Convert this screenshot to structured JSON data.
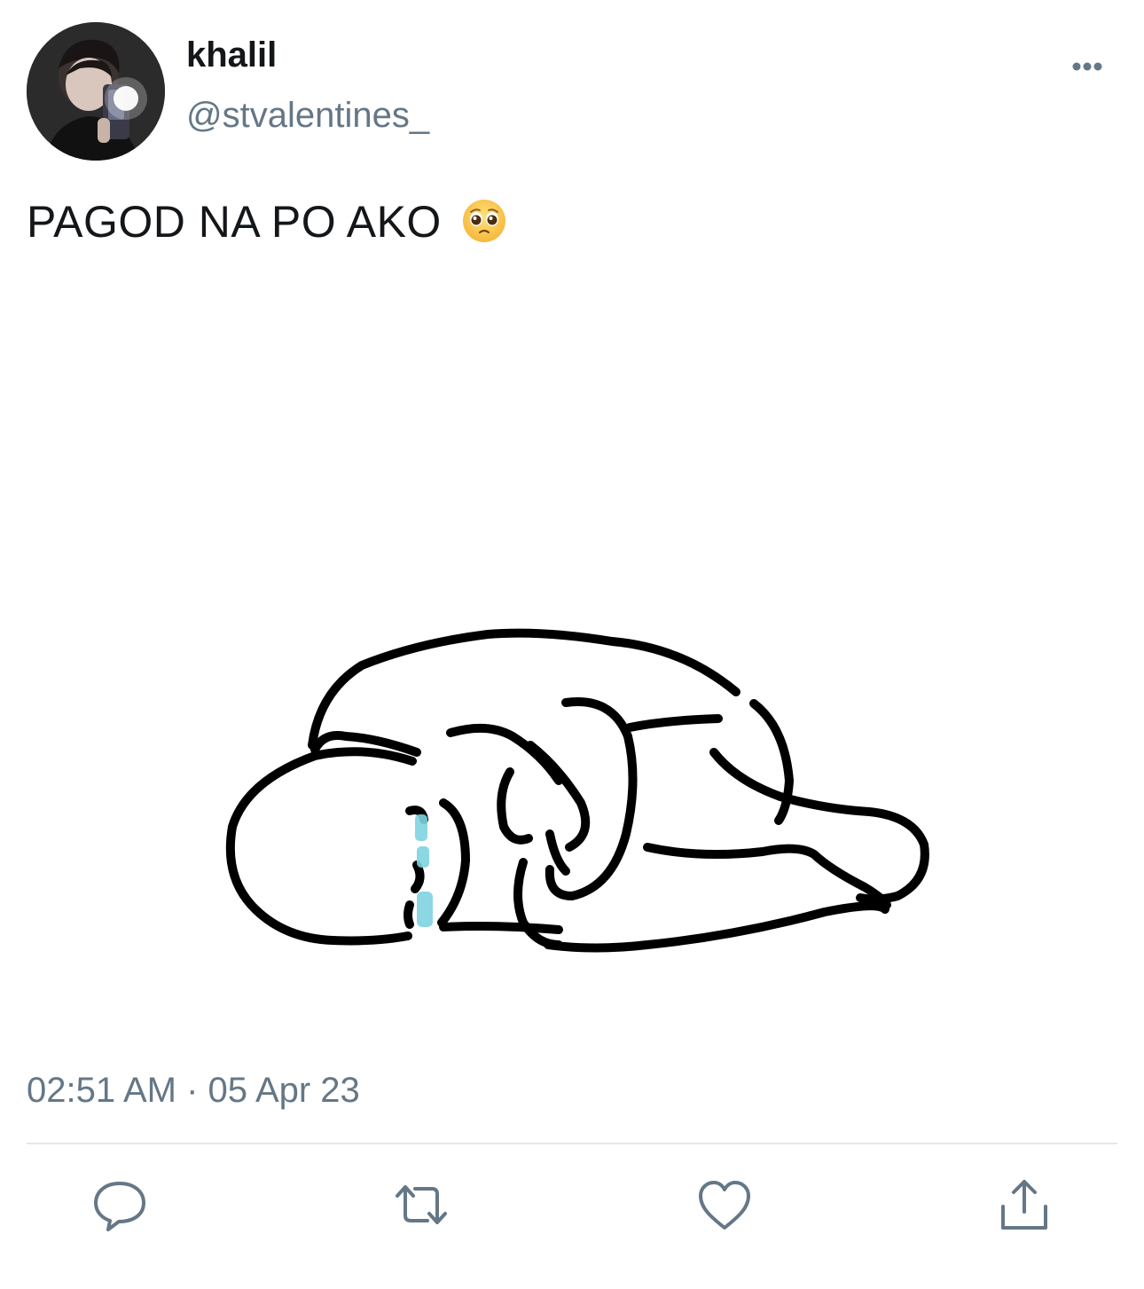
{
  "user": {
    "display_name": "khalil",
    "handle": "@stvalentines_"
  },
  "tweet": {
    "text": "PAGOD NA PO AKO",
    "emoji_icon": "pleading-face-emoji",
    "timestamp": "02:51 AM · 05 Apr 23"
  },
  "actions": {
    "reply_icon": "reply-icon",
    "retweet_icon": "retweet-icon",
    "like_icon": "heart-icon",
    "share_icon": "share-icon",
    "more_icon": "more-options-icon"
  },
  "colors": {
    "text_primary": "#14171a",
    "text_secondary": "#657786",
    "divider": "#e1e8ed",
    "icon": "#657786",
    "tear": "#7fd3e0"
  }
}
